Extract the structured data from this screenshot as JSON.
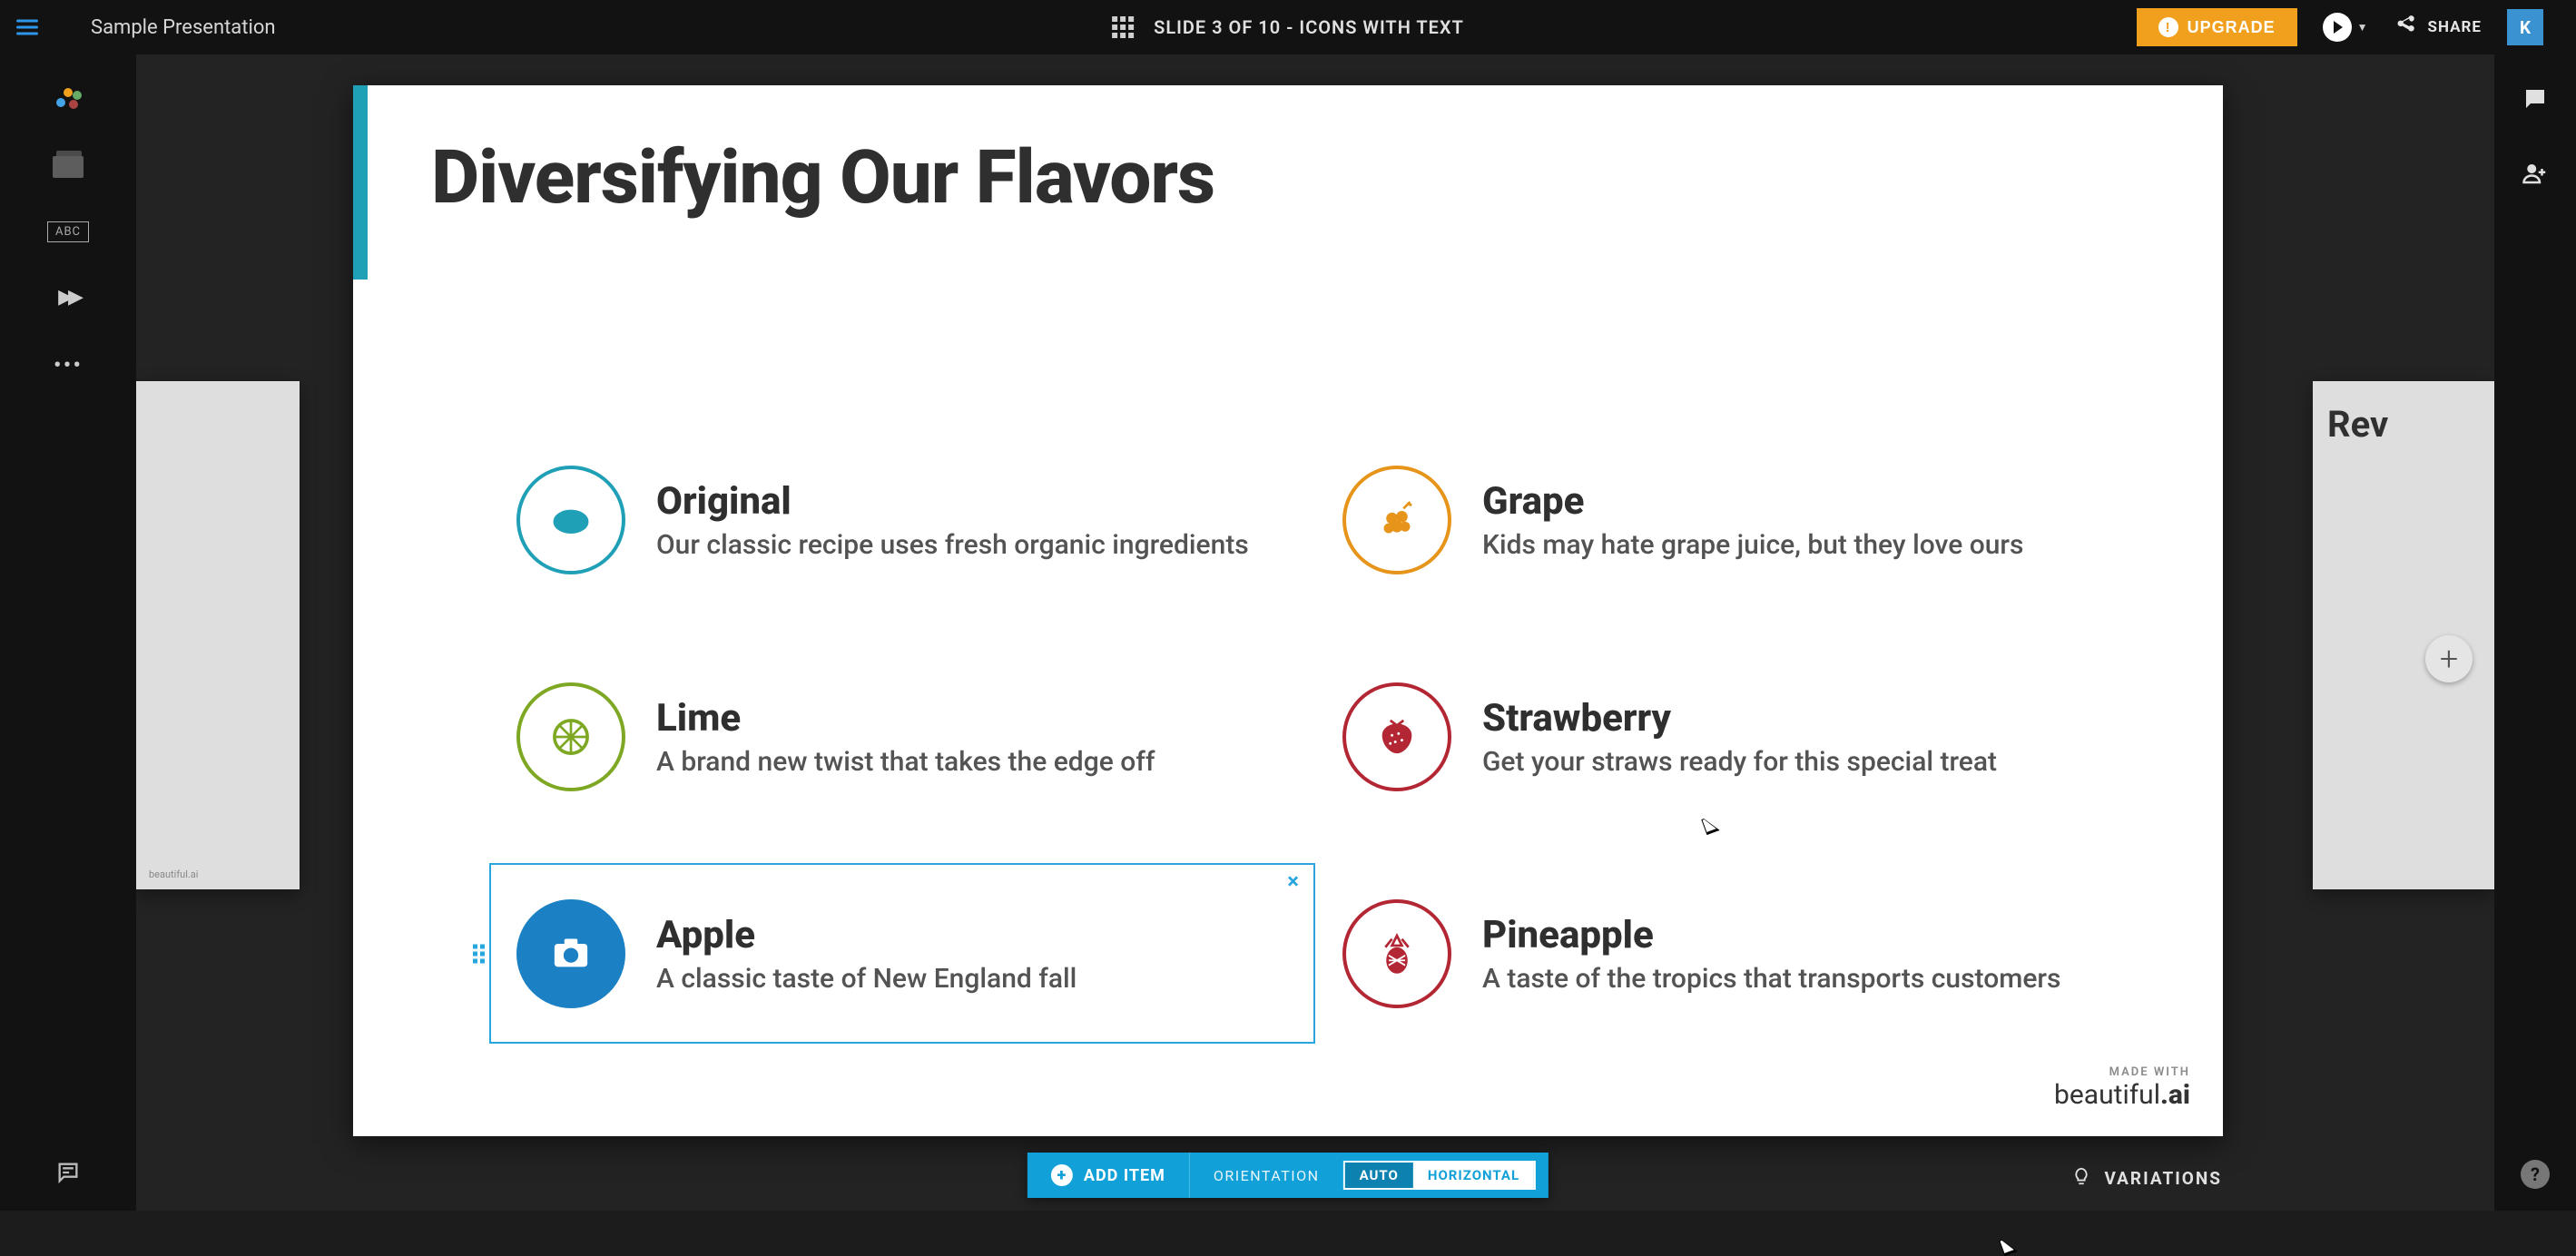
{
  "header": {
    "title": "Sample Presentation",
    "slide_indicator": "SLIDE 3 OF 10 - ICONS WITH TEXT",
    "upgrade_label": "UPGRADE",
    "share_label": "SHARE",
    "avatar_initial": "K"
  },
  "slide": {
    "title": "Diversifying Our Flavors",
    "items": [
      {
        "title": "Original",
        "desc": "Our classic recipe uses fresh organic ingredients",
        "color": "teal",
        "icon": "lemon"
      },
      {
        "title": "Grape",
        "desc": "Kids may hate grape juice, but they love ours",
        "color": "orange",
        "icon": "grapes"
      },
      {
        "title": "Lime",
        "desc": "A brand new twist that takes the edge off",
        "color": "green",
        "icon": "citrus"
      },
      {
        "title": "Strawberry",
        "desc": "Get your straws ready for this special treat",
        "color": "red",
        "icon": "strawberry"
      },
      {
        "title": "Apple",
        "desc": "A classic taste of New England fall",
        "color": "blue",
        "icon": "camera",
        "selected": true
      },
      {
        "title": "Pineapple",
        "desc": "A taste of the tropics that transports customers",
        "color": "red",
        "icon": "pineapple"
      }
    ],
    "watermark_small": "MADE WITH",
    "watermark_brand_a": "beautiful",
    "watermark_brand_b": ".ai"
  },
  "neighbor_right_title": "Rev",
  "neighbor_left_brand": "beautiful.ai",
  "toolbar": {
    "add_item": "ADD ITEM",
    "orientation_label": "ORIENTATION",
    "auto": "AUTO",
    "horizontal": "HORIZONTAL"
  },
  "variations_label": "VARIATIONS"
}
